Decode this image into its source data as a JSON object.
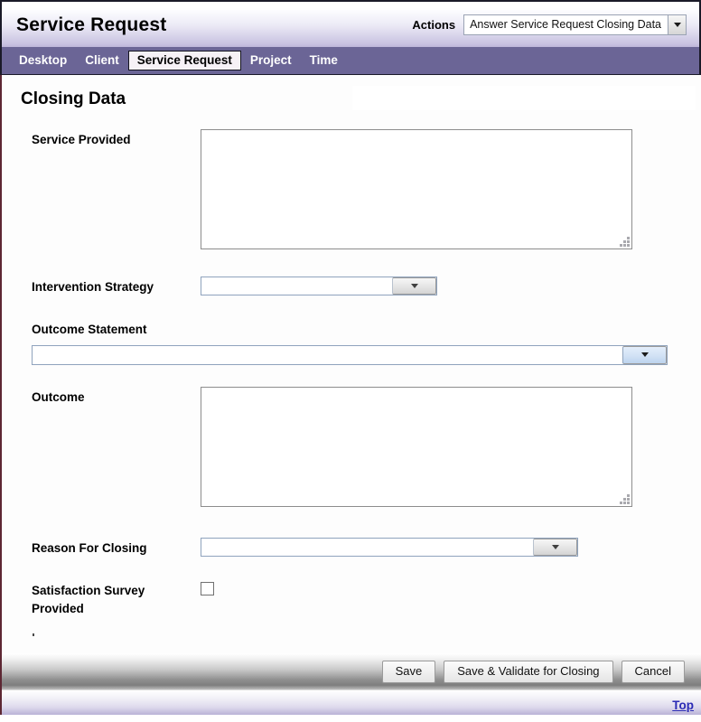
{
  "header": {
    "app_title": "Service Request",
    "actions_label": "Actions",
    "actions_selected": "Answer Service Request Closing Data",
    "dropdown_icon": "chevron-down-icon"
  },
  "nav": {
    "tabs": [
      {
        "label": "Desktop",
        "active": false
      },
      {
        "label": "Client",
        "active": false
      },
      {
        "label": "Service Request",
        "active": true
      },
      {
        "label": "Project",
        "active": false
      },
      {
        "label": "Time",
        "active": false
      }
    ]
  },
  "page": {
    "title": "Closing Data"
  },
  "form": {
    "service_provided": {
      "label": "Service Provided",
      "value": "",
      "control": "textarea",
      "resize_grip_icon": "resize-grip-icon"
    },
    "intervention_strategy": {
      "label": "Intervention Strategy",
      "value": "",
      "control": "select",
      "icon": "chevron-down-icon"
    },
    "outcome_statement": {
      "label": "Outcome Statement",
      "value": "",
      "control": "select",
      "icon": "chevron-down-icon"
    },
    "outcome": {
      "label": "Outcome",
      "value": "",
      "control": "textarea",
      "resize_grip_icon": "resize-grip-icon"
    },
    "reason_for_closing": {
      "label": "Reason For Closing",
      "value": "",
      "control": "select",
      "icon": "chevron-down-icon"
    },
    "satisfaction_survey": {
      "label_line1": "Satisfaction Survey",
      "label_line2": "Provided",
      "checked": false,
      "control": "checkbox"
    }
  },
  "footer": {
    "buttons": [
      {
        "label": "Save",
        "name": "save-button"
      },
      {
        "label": "Save & Validate for Closing",
        "name": "save-validate-button"
      },
      {
        "label": "Cancel",
        "name": "cancel-button"
      }
    ],
    "top_link": "Top"
  },
  "colors": {
    "nav_background": "#6b6596",
    "title_gradient_end": "#bdb6da",
    "border_dark": "#1a1a28",
    "content_border": "#5d2733",
    "link": "#2b2bb5",
    "select_border": "#8fa3bd",
    "textarea_border": "#8d8d8d"
  }
}
